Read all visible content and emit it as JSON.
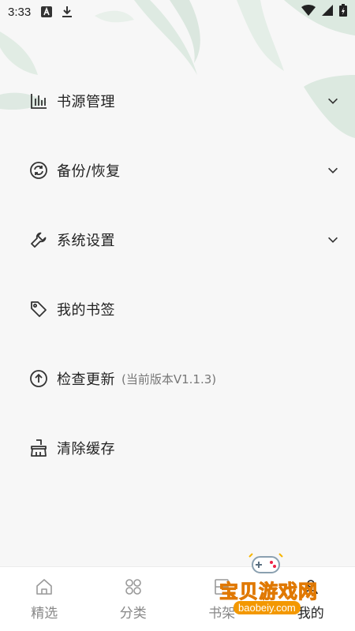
{
  "status_bar": {
    "time": "3:33"
  },
  "menu": [
    {
      "label": "书源管理",
      "icon": "bar-chart-icon",
      "expandable": true
    },
    {
      "label": "备份/恢复",
      "icon": "sync-icon",
      "expandable": true
    },
    {
      "label": "系统设置",
      "icon": "wrench-icon",
      "expandable": true
    },
    {
      "label": "我的书签",
      "icon": "tag-icon",
      "expandable": false
    },
    {
      "label": "检查更新",
      "sublabel": "(当前版本V1.1.3)",
      "icon": "arrow-up-circle-icon",
      "expandable": false
    },
    {
      "label": "清除缓存",
      "icon": "broom-icon",
      "expandable": false
    }
  ],
  "tabbar": {
    "tabs": [
      {
        "label": "精选",
        "icon": "home-icon"
      },
      {
        "label": "分类",
        "icon": "grid-icon"
      },
      {
        "label": "书架",
        "icon": "bookshelf-icon"
      },
      {
        "label": "我的",
        "icon": "user-icon"
      }
    ],
    "active_index": 3
  },
  "watermark": {
    "text": "宝贝游戏网",
    "url": "baobeiy.com"
  },
  "colors": {
    "background": "#f7f7f7",
    "tabbar": "#ffffff",
    "text": "#222222",
    "muted": "#888888",
    "watermark": "#f6b400"
  }
}
